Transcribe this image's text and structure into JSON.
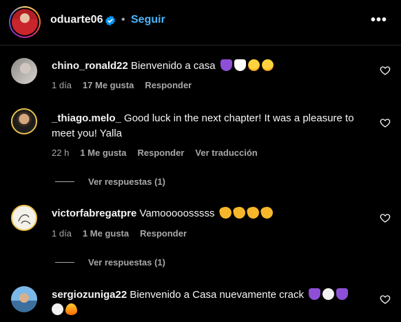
{
  "post": {
    "username": "oduarte06",
    "separator": "•",
    "follow_label": "Seguir",
    "more_label": "•••"
  },
  "comments": [
    {
      "username": "chino_ronald22",
      "text": "Bienvenido a casa",
      "emojis": [
        "purple-heart-icon",
        "white-heart-icon",
        "grinning-face-icon",
        "heart-eyes-icon"
      ],
      "time": "1 día",
      "likes": "17 Me gusta",
      "reply": "Responder"
    },
    {
      "username": "_thiago.melo_",
      "text": "Good luck in the next chapter! It was a pleasure to meet you! Yalla",
      "time": "22 h",
      "likes": "1 Me gusta",
      "reply": "Responder",
      "translate": "Ver traducción",
      "view_replies": "Ver respuestas (1)"
    },
    {
      "username": "victorfabregatpre",
      "text": "Vamooooosssss",
      "emojis": [
        "clap-icon",
        "clap-icon",
        "clap-icon",
        "clap-icon"
      ],
      "time": "1 día",
      "likes": "1 Me gusta",
      "reply": "Responder",
      "view_replies": "Ver respuestas (1)"
    },
    {
      "username": "sergiozuniga22",
      "text": "Bienvenido a Casa nuevamente crack",
      "emojis": [
        "purple-heart-icon",
        "white-circle-icon",
        "purple-heart-icon",
        "white-circle-icon",
        "fire-icon"
      ]
    }
  ],
  "colors": {
    "background": "#000000",
    "text": "#f5f5f5",
    "muted": "#a8a8a8",
    "link": "#4cb5f9",
    "verified": "#0095f6"
  }
}
